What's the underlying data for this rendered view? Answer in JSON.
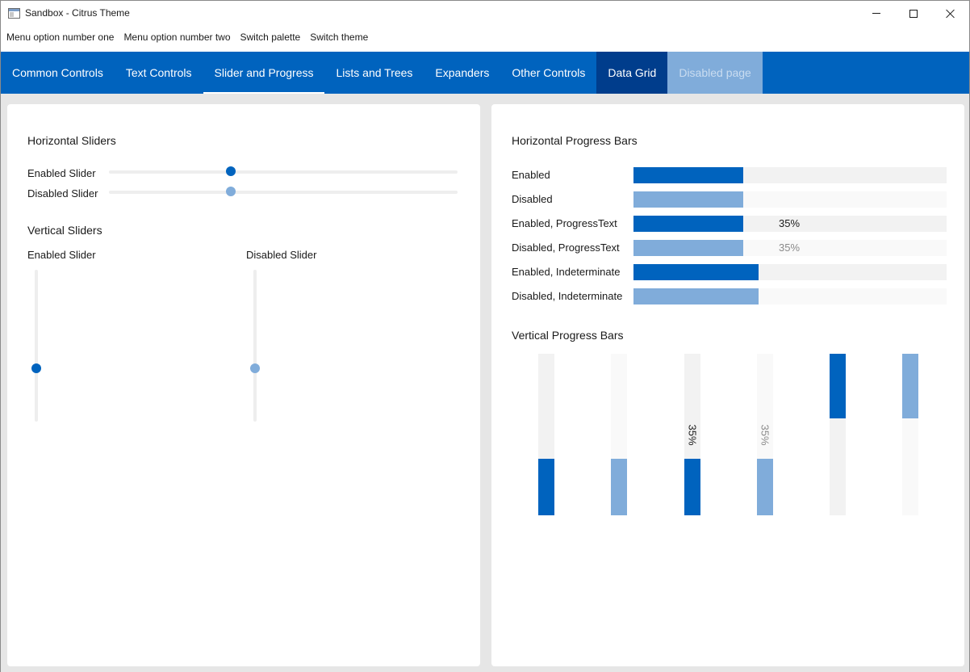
{
  "window": {
    "title": "Sandbox - Citrus Theme",
    "icon": "app-window-icon",
    "controls": [
      "minimize-icon",
      "maximize-icon",
      "close-icon"
    ]
  },
  "menu": {
    "items": [
      "Menu option number one",
      "Menu option number two",
      "Switch palette",
      "Switch theme"
    ]
  },
  "tabs": [
    {
      "label": "Common Controls",
      "state": "normal"
    },
    {
      "label": "Text Controls",
      "state": "normal"
    },
    {
      "label": "Slider and Progress",
      "state": "selected"
    },
    {
      "label": "Lists and Trees",
      "state": "normal"
    },
    {
      "label": "Expanders",
      "state": "normal"
    },
    {
      "label": "Other Controls",
      "state": "normal"
    },
    {
      "label": "Data Grid",
      "state": "hover"
    },
    {
      "label": "Disabled page",
      "state": "disabled"
    }
  ],
  "left_panel": {
    "horizontal_heading": "Horizontal Sliders",
    "horizontal_sliders": [
      {
        "label": "Enabled Slider",
        "value": 0.35,
        "enabled": true
      },
      {
        "label": "Disabled Slider",
        "value": 0.35,
        "enabled": false
      }
    ],
    "vertical_heading": "Vertical Sliders",
    "vertical_sliders": [
      {
        "label": "Enabled Slider",
        "value": 0.35,
        "enabled": true
      },
      {
        "label": "Disabled Slider",
        "value": 0.35,
        "enabled": false
      }
    ]
  },
  "right_panel": {
    "horizontal_heading": "Horizontal Progress Bars",
    "horizontal_bars": [
      {
        "label": "Enabled",
        "value": 0.35,
        "enabled": true,
        "show_text": false,
        "indeterminate": false
      },
      {
        "label": "Disabled",
        "value": 0.35,
        "enabled": false,
        "show_text": false,
        "indeterminate": false
      },
      {
        "label": "Enabled, ProgressText",
        "value": 0.35,
        "enabled": true,
        "show_text": true,
        "text": "35%",
        "indeterminate": false
      },
      {
        "label": "Disabled, ProgressText",
        "value": 0.35,
        "enabled": false,
        "show_text": true,
        "text": "35%",
        "indeterminate": false
      },
      {
        "label": "Enabled, Indeterminate",
        "value": 0.4,
        "enabled": true,
        "show_text": false,
        "indeterminate": true
      },
      {
        "label": "Disabled, Indeterminate",
        "value": 0.4,
        "enabled": false,
        "show_text": false,
        "indeterminate": true
      }
    ],
    "vertical_heading": "Vertical Progress Bars",
    "vertical_bars": [
      {
        "value": 0.35,
        "enabled": true,
        "show_text": false,
        "indeterminate": false
      },
      {
        "value": 0.35,
        "enabled": false,
        "show_text": false,
        "indeterminate": false
      },
      {
        "value": 0.35,
        "enabled": true,
        "show_text": true,
        "text": "35%",
        "indeterminate": false
      },
      {
        "value": 0.35,
        "enabled": false,
        "show_text": true,
        "text": "35%",
        "indeterminate": false
      },
      {
        "value": 0.4,
        "enabled": true,
        "show_text": false,
        "indeterminate": true
      },
      {
        "value": 0.4,
        "enabled": false,
        "show_text": false,
        "indeterminate": true
      }
    ]
  },
  "colors": {
    "accent": "#0063be",
    "accent_dark": "#003d8c",
    "accent_disabled": "#80acda",
    "track": "#f2f2f2",
    "track_disabled": "#f9f9f9",
    "page_background": "#e6e6e6"
  }
}
